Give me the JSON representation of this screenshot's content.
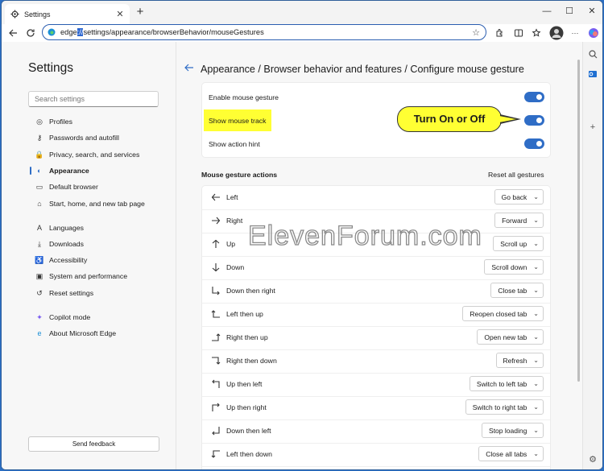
{
  "window": {
    "tab_title": "Settings",
    "address_prefix": "edge",
    "address_highlight": "://",
    "address_rest": "settings/appearance/browserBehavior/mouseGestures",
    "min": "—",
    "max": "☐",
    "close": "✕",
    "newtab": "+"
  },
  "sidebar": {
    "title": "Settings",
    "search_placeholder": "Search settings",
    "items": [
      {
        "label": "Profiles",
        "icon": "profile-icon"
      },
      {
        "label": "Passwords and autofill",
        "icon": "key-icon"
      },
      {
        "label": "Privacy, search, and services",
        "icon": "lock-icon"
      },
      {
        "label": "Appearance",
        "icon": "appearance-icon"
      },
      {
        "label": "Default browser",
        "icon": "browser-icon"
      },
      {
        "label": "Start, home, and new tab page",
        "icon": "home-icon"
      },
      {
        "label": "Languages",
        "icon": "languages-icon"
      },
      {
        "label": "Downloads",
        "icon": "download-icon"
      },
      {
        "label": "Accessibility",
        "icon": "accessibility-icon"
      },
      {
        "label": "System and performance",
        "icon": "system-icon"
      },
      {
        "label": "Reset settings",
        "icon": "reset-icon"
      },
      {
        "label": "Copilot mode",
        "icon": "copilot-icon"
      },
      {
        "label": "About Microsoft Edge",
        "icon": "edge-icon"
      }
    ],
    "feedback": "Send feedback"
  },
  "main": {
    "title": "Appearance / Browser behavior and features / Configure mouse gesture",
    "toggles": [
      {
        "label": "Enable mouse gesture",
        "on": true
      },
      {
        "label": "Show mouse track",
        "on": true
      },
      {
        "label": "Show action hint",
        "on": true
      }
    ],
    "callout": "Turn On or Off",
    "actions_heading": "Mouse gesture actions",
    "reset_all": "Reset all gestures",
    "gestures": [
      {
        "label": "Left",
        "action": "Go back",
        "icon": "arrow-left-icon"
      },
      {
        "label": "Right",
        "action": "Forward",
        "icon": "arrow-right-icon"
      },
      {
        "label": "Up",
        "action": "Scroll up",
        "icon": "arrow-up-icon"
      },
      {
        "label": "Down",
        "action": "Scroll down",
        "icon": "arrow-down-icon"
      },
      {
        "label": "Down then right",
        "action": "Close tab",
        "icon": "down-right-icon"
      },
      {
        "label": "Left then up",
        "action": "Reopen closed tab",
        "icon": "left-up-icon"
      },
      {
        "label": "Right then up",
        "action": "Open new tab",
        "icon": "right-up-icon"
      },
      {
        "label": "Right then down",
        "action": "Refresh",
        "icon": "right-down-icon"
      },
      {
        "label": "Up then left",
        "action": "Switch to left tab",
        "icon": "up-left-icon"
      },
      {
        "label": "Up then right",
        "action": "Switch to right tab",
        "icon": "up-right-icon"
      },
      {
        "label": "Down then left",
        "action": "Stop loading",
        "icon": "down-left-icon"
      },
      {
        "label": "Left then down",
        "action": "Close all tabs",
        "icon": "left-down-icon"
      }
    ]
  },
  "watermark": "ElevenForum.com",
  "colors": {
    "accent": "#2f6dc6",
    "highlight": "#ffff33"
  }
}
